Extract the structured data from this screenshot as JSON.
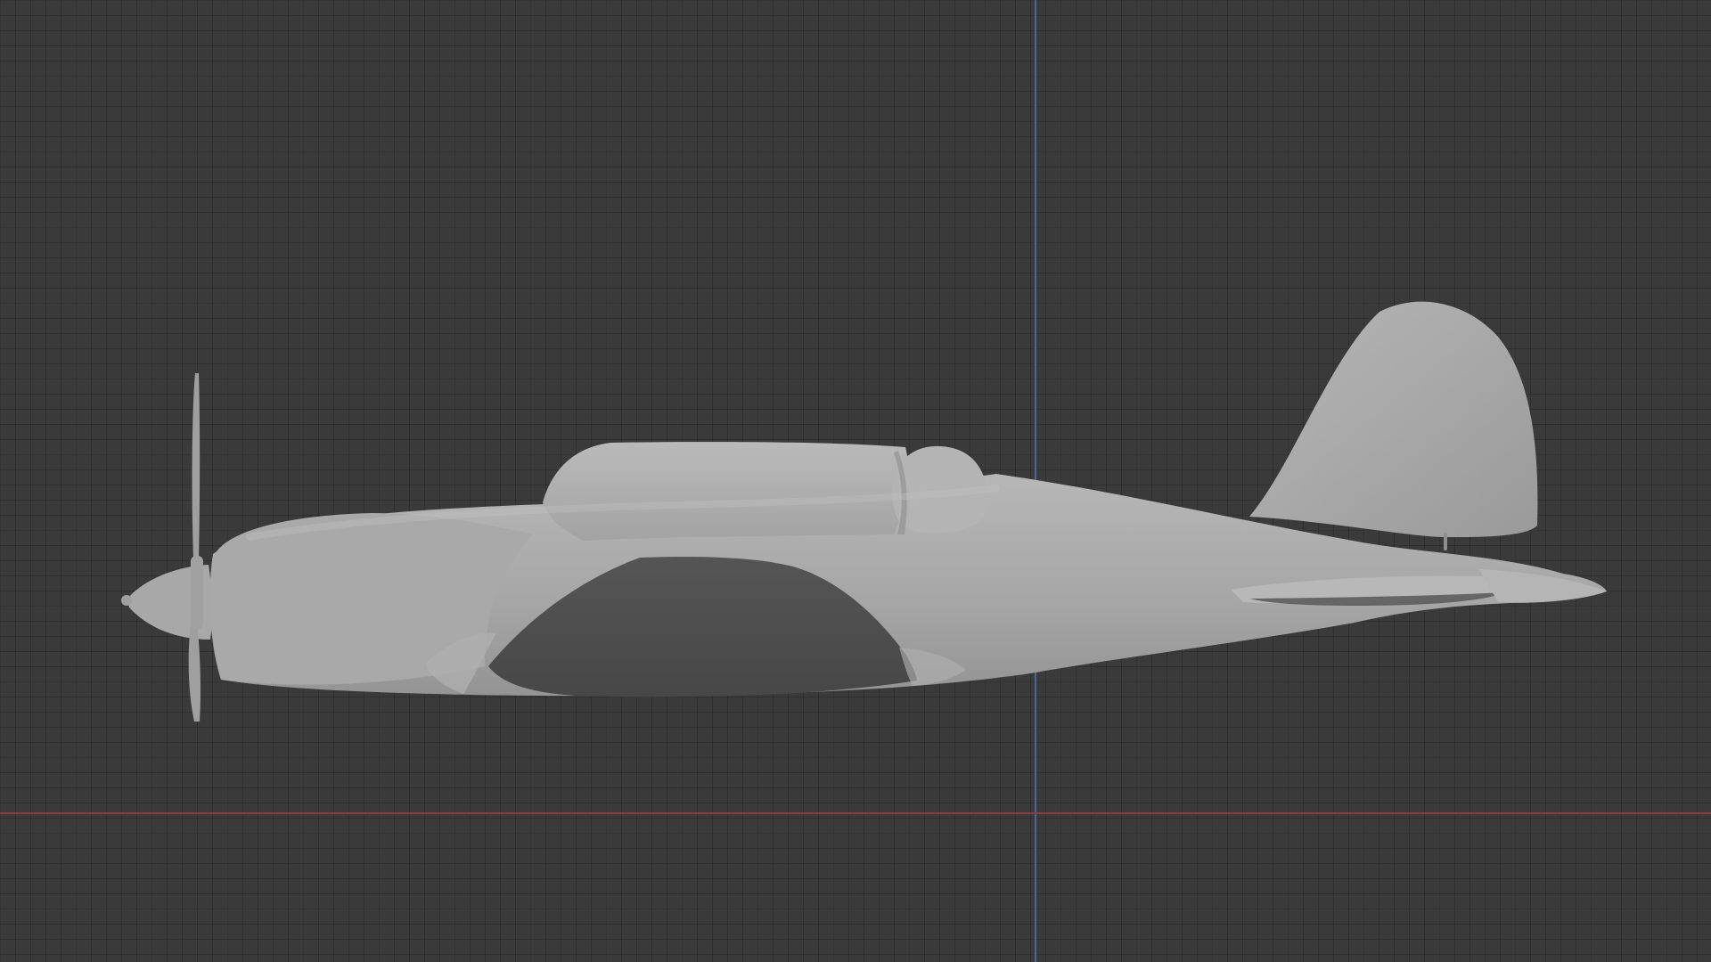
{
  "viewport": {
    "background_color": "#3a3a3a",
    "grid_color": "#2b2b2b",
    "axis_x_color": "#8f3b45",
    "axis_y_color": "#4a6ea8",
    "model_color": "#a9a9a9",
    "shadow_color": "#4a4a4a"
  },
  "scene": {
    "object_name": "airplane-model"
  }
}
